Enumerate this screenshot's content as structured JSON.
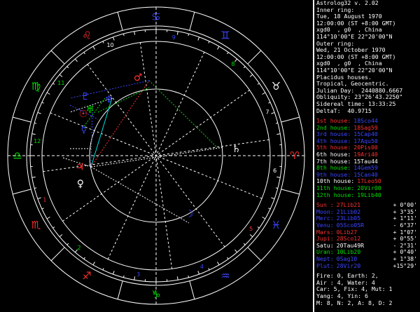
{
  "app": {
    "title": "Astrolog32 v. 2.02"
  },
  "inner": {
    "label": "Inner ring:",
    "date": "Tue, 18 August 1970",
    "time": "12:00:00 (ST +8:00 GMT)",
    "place": "xgd0  , g0  , China",
    "coords": "114°10'00\"E 22°20'00\"N"
  },
  "outer": {
    "label": "Outer ring:",
    "date": "Wed, 21 October 1970",
    "time": "12:00:00 (ST +8:00 GMT)",
    "place": "xgd0  , g0  , China",
    "coords": "114°10'00\"E 22°20'00\"N"
  },
  "settings": {
    "house_system": "Placidus houses.",
    "zodiac": "Tropical, Geocentric.",
    "julian": "Julian Day:  2440880.6667",
    "obliquity": "Obliquity: 23°26'43.2250\"",
    "sidereal": "Sidereal time: 13:33:25",
    "deltat": "DeltaT:  40.9715"
  },
  "houses": [
    {
      "label": "1st house:",
      "value": "18Sco44",
      "color": "#3c46ff"
    },
    {
      "label": "2nd house:",
      "value": "18Sag59",
      "color": "#ff3030"
    },
    {
      "label": "3rd house:",
      "value": "15Cap40",
      "color": "#3c46ff"
    },
    {
      "label": "4th house:",
      "value": "17Aqu50",
      "color": "#3c46ff"
    },
    {
      "label": "5th house:",
      "value": "20Pis00",
      "color": "#ff3030"
    },
    {
      "label": "6th house:",
      "value": "19Ari40",
      "color": "#ff3030"
    },
    {
      "label": "7th house:",
      "value": "15Tau44",
      "color": "#ffffff"
    },
    {
      "label": "8th house:",
      "value": "14Gem59",
      "color": "#3c46ff"
    },
    {
      "label": "9th house:",
      "value": "15Can40",
      "color": "#3c46ff"
    },
    {
      "label": "10th house:",
      "value": "17Leo50",
      "color": "#ff3030"
    },
    {
      "label": "11th house:",
      "value": "20Vir00",
      "color": "#00e000"
    },
    {
      "label": "12th house:",
      "value": "19Lib40",
      "color": "#00e000"
    }
  ],
  "house_label_colors": [
    "#ff3030",
    "#00e000",
    "#3c46ff",
    "#3c46ff",
    "#ff3030",
    "#ffffff",
    "#ffffff",
    "#00e000",
    "#3c46ff",
    "#ffffff",
    "#00e000",
    "#00e000"
  ],
  "planets": [
    {
      "name": "Sun :",
      "pos": "27Lib21",
      "lat": "+ 0°00'",
      "color": "#ff3030"
    },
    {
      "name": "Moon:",
      "pos": "21Lib02",
      "lat": "+ 3°35'",
      "color": "#3c46ff"
    },
    {
      "name": "Merc:",
      "pos": "23Lib05",
      "lat": "+ 1°11'",
      "color": "#3c46ff"
    },
    {
      "name": "Venu:",
      "pos": "05Sco05R",
      "lat": "- 6°37'",
      "color": "#3c46ff"
    },
    {
      "name": "Mars:",
      "pos": "0Lib27",
      "lat": "+ 1°07'",
      "color": "#ff3030"
    },
    {
      "name": "Jupi:",
      "pos": "28Sco12",
      "lat": "+ 0°55'",
      "color": "#ff3030"
    },
    {
      "name": "Satu:",
      "pos": "20Tau49R",
      "lat": "- 2°31'",
      "color": "#ffffff"
    },
    {
      "name": "Uran:",
      "pos": "10Lib20",
      "lat": "+ 0°40'",
      "color": "#00e000"
    },
    {
      "name": "Nept:",
      "pos": "0Sag10",
      "lat": "+ 1°38'",
      "color": "#3c46ff"
    },
    {
      "name": "Plut:",
      "pos": "28Vir20",
      "lat": "+15°29'",
      "color": "#3c46ff"
    }
  ],
  "elements": {
    "l1": "Fire: 0, Earth: 2,",
    "l2": "Air : 4, Water: 4",
    "l3": "Car: 5, Fix: 4, Mut: 1",
    "l4": "Yang: 4, Yin: 6",
    "l5": "M: 8, N: 2, A: 8, D: 2"
  },
  "wheel": {
    "house_numbers": [
      "1",
      "2",
      "3",
      "4",
      "5",
      "6",
      "7",
      "8",
      "9",
      "10",
      "11",
      "12"
    ],
    "sign_glyphs": [
      "♈",
      "♉",
      "♊",
      "♋",
      "♌",
      "♍",
      "♎",
      "♏",
      "♐",
      "♑",
      "♒",
      "♓"
    ],
    "sign_colors": [
      "#ff3030",
      "#ffffff",
      "#3c46ff",
      "#3c46ff",
      "#ff3030",
      "#00e000",
      "#00e000",
      "#ff3030",
      "#ff3030",
      "#00e000",
      "#3c46ff",
      "#3c46ff"
    ],
    "planet_glyphs": [
      {
        "glyph": "♀",
        "color": "#ffffff"
      },
      {
        "glyph": "♃",
        "color": "#ff3030"
      },
      {
        "glyph": "☽",
        "color": "#3c46ff"
      },
      {
        "glyph": "♂",
        "color": "#ff3030"
      },
      {
        "glyph": "♄",
        "color": "#ffffff"
      },
      {
        "glyph": "♅",
        "color": "#00e000"
      },
      {
        "glyph": "♆",
        "color": "#3c46ff"
      },
      {
        "glyph": "♇",
        "color": "#3c46ff"
      },
      {
        "glyph": "☉",
        "color": "#ff3030"
      },
      {
        "glyph": "☿",
        "color": "#3c46ff"
      }
    ]
  }
}
